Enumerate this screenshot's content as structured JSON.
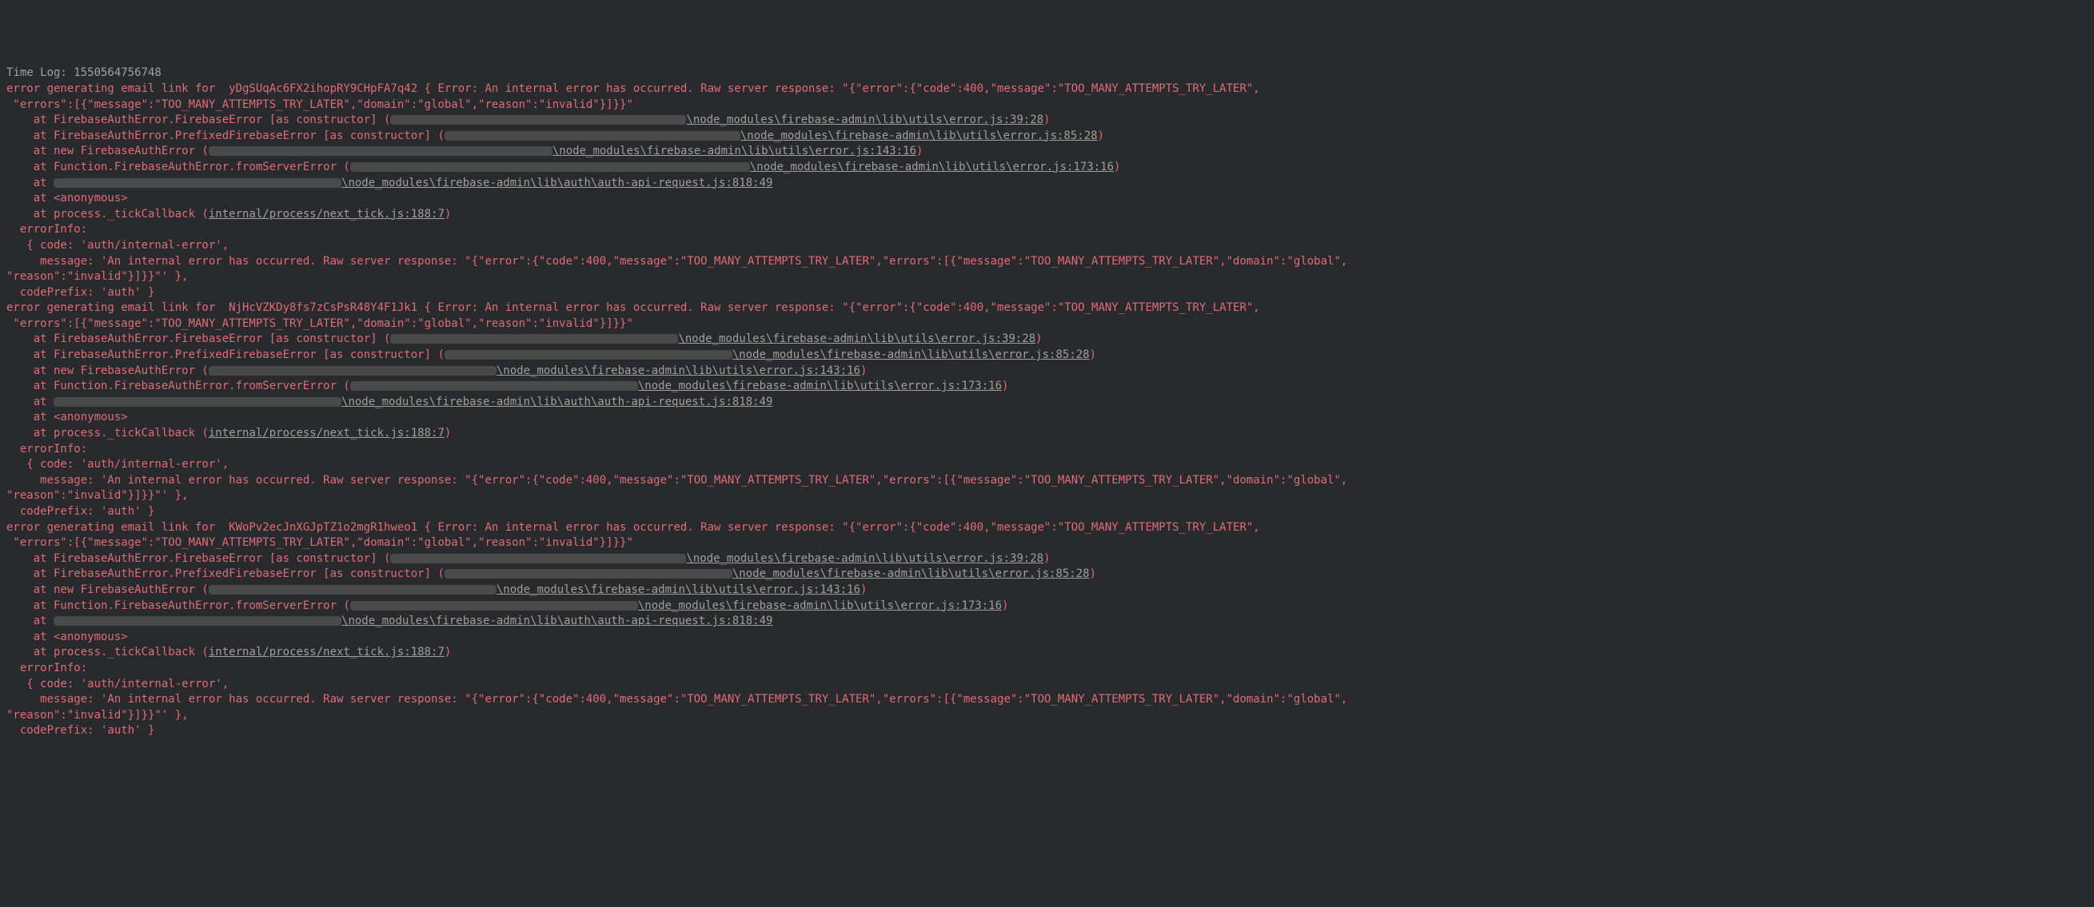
{
  "timelog": "Time Log: 1550564756748",
  "errors": [
    {
      "header_a": "error generating email link for  yDgSUqAc6FX2ihopRY9CHpFA7q42 { Error: An internal error has occurred. Raw server response: \"{\"error\":{\"code\":400,\"message\":\"TOO_MANY_ATTEMPTS_TRY_LATER\",",
      "header_b": " \"errors\":[{\"message\":\"TOO_MANY_ATTEMPTS_TRY_LATER\",\"domain\":\"global\",\"reason\":\"invalid\"}]}}\"",
      "stack": [
        {
          "pre": "    at FirebaseAuthError.FirebaseError [as constructor] (",
          "redact_w": 370,
          "tail": "\\node_modules\\firebase-admin\\lib\\utils\\error.js:39:28",
          "close": ")"
        },
        {
          "pre": "    at FirebaseAuthError.PrefixedFirebaseError [as constructor] (",
          "redact_w": 370,
          "tail": "\\node_modules\\firebase-admin\\lib\\utils\\error.js:85:28",
          "close": ")"
        },
        {
          "pre": "    at new FirebaseAuthError (",
          "redact_w": 430,
          "tail": "\\node_modules\\firebase-admin\\lib\\utils\\error.js:143:16",
          "close": ")"
        },
        {
          "pre": "    at Function.FirebaseAuthError.fromServerError (",
          "redact_w": 500,
          "tail": "\\node_modules\\firebase-admin\\lib\\utils\\error.js:173:16",
          "close": ")"
        },
        {
          "pre": "    at ",
          "redact_w": 360,
          "tail": "\\node_modules\\firebase-admin\\lib\\auth\\auth-api-request.js:818:49",
          "close": ""
        },
        {
          "pre": "    at <anonymous>",
          "redact_w": 0,
          "tail": "",
          "close": ""
        },
        {
          "pre": "    at process._tickCallback (",
          "redact_w": 0,
          "tail": "internal/process/next_tick.js:188:7",
          "close": ")"
        }
      ],
      "info_label": "  errorInfo:",
      "info_code": "   { code: 'auth/internal-error',",
      "info_msg": "     message: 'An internal error has occurred. Raw server response: \"{\"error\":{\"code\":400,\"message\":\"TOO_MANY_ATTEMPTS_TRY_LATER\",\"errors\":[{\"message\":\"TOO_MANY_ATTEMPTS_TRY_LATER\",\"domain\":\"global\",\n\"reason\":\"invalid\"}]}}\"' },",
      "code_prefix": "  codePrefix: 'auth' }"
    },
    {
      "header_a": "error generating email link for  NjHcVZKDy8fs7zCsPsR48Y4F1Jk1 { Error: An internal error has occurred. Raw server response: \"{\"error\":{\"code\":400,\"message\":\"TOO_MANY_ATTEMPTS_TRY_LATER\",",
      "header_b": " \"errors\":[{\"message\":\"TOO_MANY_ATTEMPTS_TRY_LATER\",\"domain\":\"global\",\"reason\":\"invalid\"}]}}\"",
      "stack": [
        {
          "pre": "    at FirebaseAuthError.FirebaseError [as constructor] (",
          "redact_w": 360,
          "tail": "\\node_modules\\firebase-admin\\lib\\utils\\error.js:39:28",
          "close": ")"
        },
        {
          "pre": "    at FirebaseAuthError.PrefixedFirebaseError [as constructor] (",
          "redact_w": 360,
          "tail": "\\node_modules\\firebase-admin\\lib\\utils\\error.js:85:28",
          "close": ")"
        },
        {
          "pre": "    at new FirebaseAuthError (",
          "redact_w": 360,
          "tail": "\\node_modules\\firebase-admin\\lib\\utils\\error.js:143:16",
          "close": ")"
        },
        {
          "pre": "    at Function.FirebaseAuthError.fromServerError (",
          "redact_w": 360,
          "tail": "\\node_modules\\firebase-admin\\lib\\utils\\error.js:173:16",
          "close": ")"
        },
        {
          "pre": "    at ",
          "redact_w": 360,
          "tail": "\\node_modules\\firebase-admin\\lib\\auth\\auth-api-request.js:818:49",
          "close": ""
        },
        {
          "pre": "    at <anonymous>",
          "redact_w": 0,
          "tail": "",
          "close": ""
        },
        {
          "pre": "    at process._tickCallback (",
          "redact_w": 0,
          "tail": "internal/process/next_tick.js:188:7",
          "close": ")"
        }
      ],
      "info_label": "  errorInfo:",
      "info_code": "   { code: 'auth/internal-error',",
      "info_msg": "     message: 'An internal error has occurred. Raw server response: \"{\"error\":{\"code\":400,\"message\":\"TOO_MANY_ATTEMPTS_TRY_LATER\",\"errors\":[{\"message\":\"TOO_MANY_ATTEMPTS_TRY_LATER\",\"domain\":\"global\",\n\"reason\":\"invalid\"}]}}\"' },",
      "code_prefix": "  codePrefix: 'auth' }"
    },
    {
      "header_a": "error generating email link for  KWoPv2ecJnXGJpTZ1o2mgR1hweo1 { Error: An internal error has occurred. Raw server response: \"{\"error\":{\"code\":400,\"message\":\"TOO_MANY_ATTEMPTS_TRY_LATER\",",
      "header_b": " \"errors\":[{\"message\":\"TOO_MANY_ATTEMPTS_TRY_LATER\",\"domain\":\"global\",\"reason\":\"invalid\"}]}}\"",
      "stack": [
        {
          "pre": "    at FirebaseAuthError.FirebaseError [as constructor] (",
          "redact_w": 370,
          "tail": "\\node_modules\\firebase-admin\\lib\\utils\\error.js:39:28",
          "close": ")"
        },
        {
          "pre": "    at FirebaseAuthError.PrefixedFirebaseError [as constructor] (",
          "redact_w": 360,
          "tail": "\\node_modules\\firebase-admin\\lib\\utils\\error.js:85:28",
          "close": ")"
        },
        {
          "pre": "    at new FirebaseAuthError (",
          "redact_w": 360,
          "tail": "\\node_modules\\firebase-admin\\lib\\utils\\error.js:143:16",
          "close": ")"
        },
        {
          "pre": "    at Function.FirebaseAuthError.fromServerError (",
          "redact_w": 360,
          "tail": "\\node_modules\\firebase-admin\\lib\\utils\\error.js:173:16",
          "close": ")"
        },
        {
          "pre": "    at ",
          "redact_w": 360,
          "tail": "\\node_modules\\firebase-admin\\lib\\auth\\auth-api-request.js:818:49",
          "close": ""
        },
        {
          "pre": "    at <anonymous>",
          "redact_w": 0,
          "tail": "",
          "close": ""
        },
        {
          "pre": "    at process._tickCallback (",
          "redact_w": 0,
          "tail": "internal/process/next_tick.js:188:7",
          "close": ")"
        }
      ],
      "info_label": "  errorInfo:",
      "info_code": "   { code: 'auth/internal-error',",
      "info_msg": "     message: 'An internal error has occurred. Raw server response: \"{\"error\":{\"code\":400,\"message\":\"TOO_MANY_ATTEMPTS_TRY_LATER\",\"errors\":[{\"message\":\"TOO_MANY_ATTEMPTS_TRY_LATER\",\"domain\":\"global\",\n\"reason\":\"invalid\"}]}}\"' },",
      "code_prefix": "  codePrefix: 'auth' }"
    }
  ]
}
